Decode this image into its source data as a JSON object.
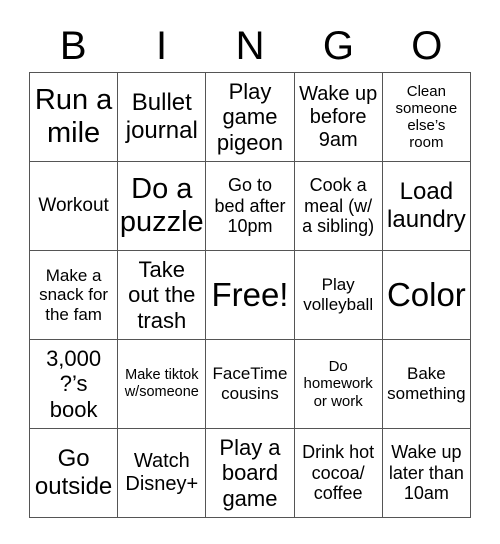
{
  "header": {
    "letters": [
      "B",
      "I",
      "N",
      "G",
      "O"
    ]
  },
  "grid": [
    [
      "Run a\nmile",
      "Bullet\njournal",
      "Play\ngame\npigeon",
      "Wake up\nbefore\n9am",
      "Clean\nsomeone\nelse’s\nroom"
    ],
    [
      "Workout",
      "Do a\npuzzle",
      "Go to\nbed after\n10pm",
      "Cook a\nmeal (w/\na sibling)",
      "Load\nlaundry"
    ],
    [
      "Make a\nsnack for\nthe fam",
      "Take\nout the\ntrash",
      "Free!",
      "Play\nvolleyball",
      "Color"
    ],
    [
      "3,000\n?’s\nbook",
      "Make tiktok\nw/someone",
      "FaceTime\ncousins",
      "Do\nhomework\nor work",
      "Bake\nsomething"
    ],
    [
      "Go\noutside",
      "Watch\nDisney+",
      "Play a\nboard\ngame",
      "Drink hot\ncocoa/\ncoffee",
      "Wake up\nlater than\n10am"
    ]
  ]
}
